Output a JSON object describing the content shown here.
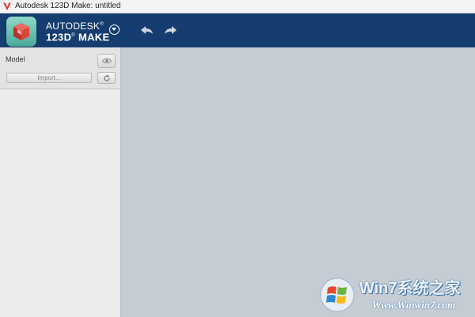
{
  "window": {
    "title": "Autodesk 123D Make: untitled",
    "app_icon": "autodesk-logo-icon"
  },
  "header": {
    "brand_line1": "AUTODESK",
    "brand_line1_mark": "®",
    "brand_line2_prefix": "123D",
    "brand_line2_mark": "®",
    "brand_line2_suffix": "MAKE",
    "menu_icon": "chevron-down-circle-icon",
    "undo_icon": "undo-arrow-icon",
    "redo_icon": "redo-arrow-icon",
    "background_color": "#163d6f"
  },
  "sidebar": {
    "model_label": "Model",
    "visibility_icon": "eye-icon",
    "import_label": "Import...",
    "refresh_icon": "refresh-icon"
  },
  "canvas": {
    "background_color": "#c5ccd4"
  },
  "watermark": {
    "logo": "windows-logo",
    "text_line1": "Win7系统之家",
    "text_line2": "Www.Winwin7.com"
  }
}
